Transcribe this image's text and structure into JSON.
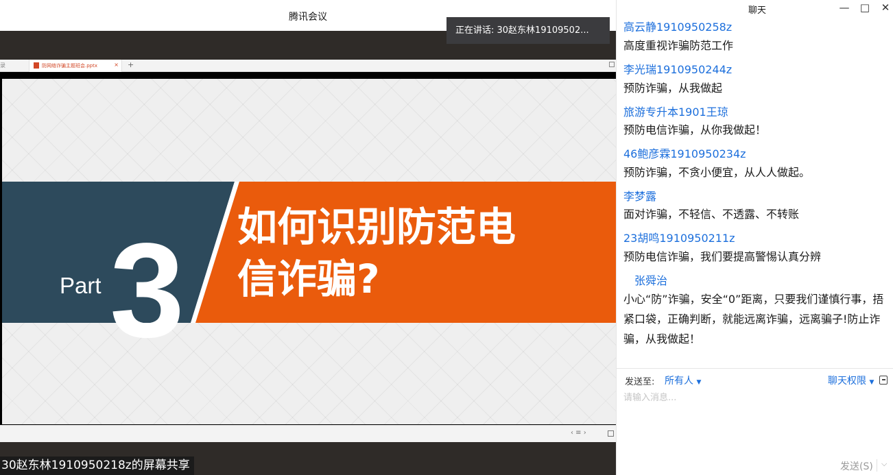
{
  "app": {
    "title": "腾讯会议",
    "speaking": "正在讲话: 30赵东林19109502..."
  },
  "browser": {
    "left_tab_fragment": "录",
    "tab_label": "防网络诈骗主题班会.pptx",
    "tab_close": "×",
    "new_tab": "+"
  },
  "slide": {
    "part_label": "Part",
    "part_number": "3",
    "title_line1": "如何识别防范电",
    "title_line2": "信诈骗?"
  },
  "controls": {
    "nav": "‹ ≡ ›"
  },
  "share_caption": "30赵东林1910950218z的屏幕共享",
  "chat": {
    "title": "聊天",
    "window_buttons": {
      "minimize": "—",
      "maximize": "□",
      "close": "✕"
    },
    "messages": [
      {
        "sender": "高云静1910950258z",
        "text": "高度重视诈骗防范工作"
      },
      {
        "sender": "李光瑞1910950244z",
        "text": "预防诈骗，从我做起"
      },
      {
        "sender": "旅游专升本1901王琼",
        "text": "预防电信诈骗，从你我做起！"
      },
      {
        "sender": "46鲍彦霖1910950234z",
        "text": "预防诈骗，不贪小便宜，从人人做起。"
      },
      {
        "sender": "李梦露",
        "text": "面对诈骗，不轻信、不透露、不转账"
      },
      {
        "sender": "23胡鸣1910950211z",
        "text": "预防电信诈骗，我们要提高警惕认真分辨"
      },
      {
        "sender": "张舜治",
        "text": "小心“防”诈骗，安全“0”距离，只要我们谨慎行事，捂紧口袋，正确判断，就能远离诈骗，远离骗子!防止诈骗，从我做起！"
      }
    ],
    "compose": {
      "send_to_label": "发送至:",
      "send_to_value": "所有人",
      "permission_label": "聊天权限",
      "placeholder": "请输入消息...",
      "send_button": "发送(S)"
    }
  },
  "colors": {
    "slide_dark": "#2d4a5c",
    "slide_orange": "#ea5b0c",
    "link_blue": "#1c6fdc",
    "background_dark": "#2f2b28"
  }
}
